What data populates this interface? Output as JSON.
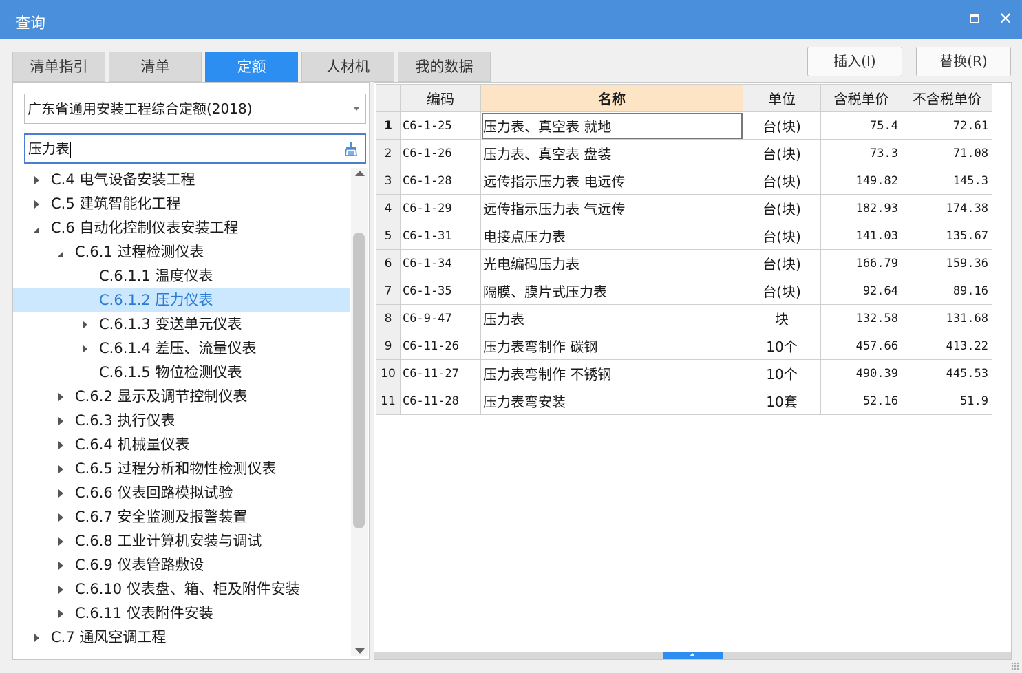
{
  "window": {
    "title": "查询"
  },
  "tabs": [
    "清单指引",
    "清单",
    "定额",
    "人材机",
    "我的数据"
  ],
  "active_tab": "定额",
  "actions": {
    "insert": "插入(I)",
    "replace": "替换(R)"
  },
  "quota_library": {
    "selected": "广东省通用安装工程综合定额(2018)"
  },
  "search": {
    "value": "压力表"
  },
  "tree": [
    {
      "label": "C.4 电气设备安装工程",
      "state": "closed",
      "level": 0
    },
    {
      "label": "C.5 建筑智能化工程",
      "state": "closed",
      "level": 0
    },
    {
      "label": "C.6 自动化控制仪表安装工程",
      "state": "open",
      "level": 0
    },
    {
      "label": "C.6.1 过程检测仪表",
      "state": "open",
      "level": 1
    },
    {
      "label": "C.6.1.1 温度仪表",
      "state": "leaf",
      "level": 2
    },
    {
      "label": "C.6.1.2 压力仪表",
      "state": "leaf",
      "level": 2,
      "selected": true
    },
    {
      "label": "C.6.1.3 变送单元仪表",
      "state": "closed",
      "level": 2
    },
    {
      "label": "C.6.1.4 差压、流量仪表",
      "state": "closed",
      "level": 2
    },
    {
      "label": "C.6.1.5 物位检测仪表",
      "state": "leaf",
      "level": 2
    },
    {
      "label": "C.6.2 显示及调节控制仪表",
      "state": "closed",
      "level": 1
    },
    {
      "label": "C.6.3 执行仪表",
      "state": "closed",
      "level": 1
    },
    {
      "label": "C.6.4 机械量仪表",
      "state": "closed",
      "level": 1
    },
    {
      "label": "C.6.5 过程分析和物性检测仪表",
      "state": "closed",
      "level": 1
    },
    {
      "label": "C.6.6 仪表回路模拟试验",
      "state": "closed",
      "level": 1
    },
    {
      "label": "C.6.7 安全监测及报警装置",
      "state": "closed",
      "level": 1
    },
    {
      "label": "C.6.8 工业计算机安装与调试",
      "state": "closed",
      "level": 1
    },
    {
      "label": "C.6.9 仪表管路敷设",
      "state": "closed",
      "level": 1
    },
    {
      "label": "C.6.10 仪表盘、箱、柜及附件安装",
      "state": "closed",
      "level": 1
    },
    {
      "label": "C.6.11 仪表附件安装",
      "state": "closed",
      "level": 1
    },
    {
      "label": "C.7 通风空调工程",
      "state": "closed",
      "level": 0
    }
  ],
  "table": {
    "columns": [
      "编码",
      "名称",
      "单位",
      "含税单价",
      "不含税单价"
    ],
    "highlighted_column": "名称",
    "current_row": 1,
    "rows": [
      {
        "idx": "1",
        "code": "C6-1-25",
        "name": "压力表、真空表 就地",
        "unit": "台(块)",
        "price_tax": "75.4",
        "price_notax": "72.61"
      },
      {
        "idx": "2",
        "code": "C6-1-26",
        "name": "压力表、真空表 盘装",
        "unit": "台(块)",
        "price_tax": "73.3",
        "price_notax": "71.08"
      },
      {
        "idx": "3",
        "code": "C6-1-28",
        "name": "远传指示压力表 电远传",
        "unit": "台(块)",
        "price_tax": "149.82",
        "price_notax": "145.3"
      },
      {
        "idx": "4",
        "code": "C6-1-29",
        "name": "远传指示压力表 气远传",
        "unit": "台(块)",
        "price_tax": "182.93",
        "price_notax": "174.38"
      },
      {
        "idx": "5",
        "code": "C6-1-31",
        "name": "电接点压力表",
        "unit": "台(块)",
        "price_tax": "141.03",
        "price_notax": "135.67"
      },
      {
        "idx": "6",
        "code": "C6-1-34",
        "name": "光电编码压力表",
        "unit": "台(块)",
        "price_tax": "166.79",
        "price_notax": "159.36"
      },
      {
        "idx": "7",
        "code": "C6-1-35",
        "name": "隔膜、膜片式压力表",
        "unit": "台(块)",
        "price_tax": "92.64",
        "price_notax": "89.16"
      },
      {
        "idx": "8",
        "code": "C6-9-47",
        "name": "压力表",
        "unit": "块",
        "price_tax": "132.58",
        "price_notax": "131.68"
      },
      {
        "idx": "9",
        "code": "C6-11-26",
        "name": "压力表弯制作 碳钢",
        "unit": "10个",
        "price_tax": "457.66",
        "price_notax": "413.22"
      },
      {
        "idx": "10",
        "code": "C6-11-27",
        "name": "压力表弯制作 不锈钢",
        "unit": "10个",
        "price_tax": "490.39",
        "price_notax": "445.53"
      },
      {
        "idx": "11",
        "code": "C6-11-28",
        "name": "压力表弯安装",
        "unit": "10套",
        "price_tax": "52.16",
        "price_notax": "51.9"
      }
    ]
  },
  "colors": {
    "titlebar": "#4a8fdb",
    "active_tab": "#2b8ef0",
    "selection": "#cce8ff",
    "header_highlight": "#fde4c4"
  }
}
